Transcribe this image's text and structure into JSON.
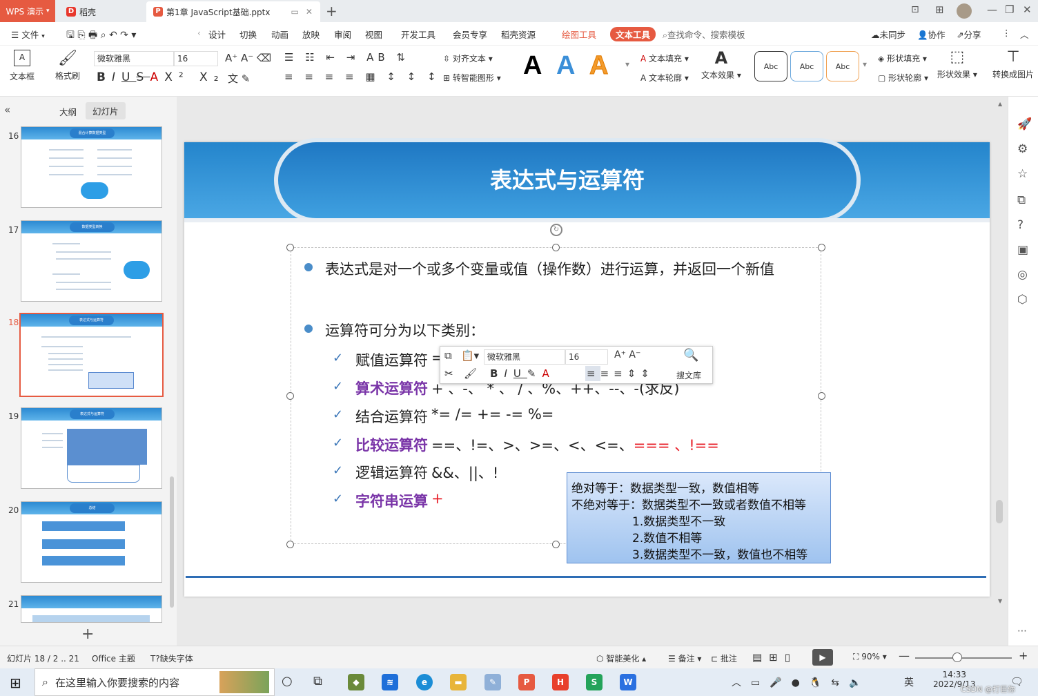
{
  "titlebar": {
    "app_tab": "WPS 演示",
    "tab2": "稻壳",
    "doc_tab": "第1章 JavaScript基础.pptx",
    "add_tab": "+"
  },
  "menubar": {
    "file": "文件",
    "items": [
      "设计",
      "切换",
      "动画",
      "放映",
      "审阅",
      "视图",
      "开发工具",
      "会员专享",
      "稻壳资源"
    ],
    "draw_tools": "绘图工具",
    "text_tools": "文本工具",
    "search": "查找命令、搜索模板",
    "unsync": "未同步",
    "collab": "协作",
    "share": "分享"
  },
  "ribbon": {
    "textbox": "文本框",
    "format_painter": "格式刷",
    "font_name": "微软雅黑",
    "font_size": "16",
    "align_text": "对齐文本",
    "smart_shape": "转智能图形",
    "text_fill": "文本填充",
    "text_outline": "文本轮廓",
    "text_effect": "文本效果",
    "abc": "Abc",
    "shape_fill": "形状填充",
    "shape_outline": "形状轮廓",
    "shape_effect": "形状效果",
    "convert": "转换成图片"
  },
  "leftpanel": {
    "outline_tab": "大纲",
    "slides_tab": "幻灯片",
    "thumbs": [
      {
        "num": "16",
        "title": "混合计算数据类型"
      },
      {
        "num": "17",
        "title": "数据类型转换"
      },
      {
        "num": "18",
        "title": "表达式与运算符"
      },
      {
        "num": "19",
        "title": "表达式与运算符"
      },
      {
        "num": "20",
        "title": "总结"
      },
      {
        "num": "21",
        "title": ""
      }
    ],
    "add": "+"
  },
  "slide": {
    "title": "表达式与运算符",
    "line1": "表达式是对一个或多个变量或值（操作数）进行运算，并返回一个新值",
    "line2": "运算符可分为以下类别：",
    "items": [
      {
        "label": "赋值运算符",
        "ops": "="
      },
      {
        "label": "算术运算符",
        "ops": "+ 、-、 * 、 / 、%、++、--、-(求反)"
      },
      {
        "label": "结合运算符",
        "ops": "*=  /=  +=  -= %="
      },
      {
        "label": "比较运算符",
        "ops": "==、!=、>、>=、<、<=、",
        "ops_red": "=== 、!=="
      },
      {
        "label": "逻辑运算符",
        "ops": "&&、||、!"
      },
      {
        "label": "字符串运算",
        "ops": "+"
      }
    ],
    "note": {
      "l1": "绝对等于：数据类型一致，数值相等",
      "l2": "不绝对等于：数据类型不一致或者数值不相等",
      "l3": "1.数据类型不一致",
      "l4": "2.数值不相等",
      "l5": "3.数据类型不一致，数值也不相等"
    }
  },
  "floatbar": {
    "font": "微软雅黑",
    "size": "16",
    "search_lib": "搜文库"
  },
  "status": {
    "slide_info": "幻灯片 18 / 2 .. 21",
    "theme": "Office 主题",
    "missing_font": "缺失字体",
    "smart": "智能美化",
    "notes": "备注",
    "comment": "批注",
    "zoom": "90%"
  },
  "taskbar": {
    "search": "在这里输入你要搜索的内容",
    "time": "14:33",
    "date": "2022/9/13",
    "lang": "英",
    "watermark": "CSDN @打巨你"
  }
}
